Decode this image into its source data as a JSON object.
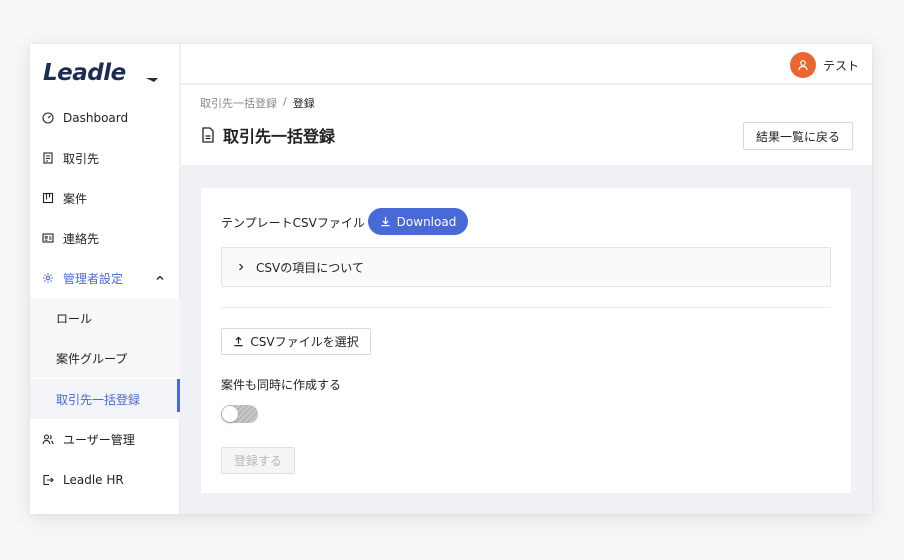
{
  "app": {
    "logo_text": "Leadle"
  },
  "sidebar": {
    "items": [
      {
        "label": "Dashboard",
        "icon": "dashboard-icon"
      },
      {
        "label": "取引先",
        "icon": "document-list-icon"
      },
      {
        "label": "案件",
        "icon": "kanban-icon"
      },
      {
        "label": "連絡先",
        "icon": "contact-card-icon"
      },
      {
        "label": "管理者設定",
        "icon": "gear-icon",
        "expanded": true
      },
      {
        "label": "ユーザー管理",
        "icon": "users-icon"
      },
      {
        "label": "Leadle HR",
        "icon": "external-link-icon"
      }
    ],
    "sub_items": [
      {
        "label": "ロール"
      },
      {
        "label": "案件グループ"
      },
      {
        "label": "取引先一括登録",
        "active": true
      }
    ]
  },
  "header": {
    "user_name": "テスト",
    "avatar_color": "#e8662f"
  },
  "breadcrumb": {
    "parent": "取引先一括登録",
    "separator": "/",
    "current": "登録"
  },
  "page": {
    "title": "取引先一括登録",
    "back_button": "結果一覧に戻る"
  },
  "form": {
    "template_label": "テンプレートCSVファイル",
    "download_button": "Download",
    "collapse_label": "CSVの項目について",
    "select_file_button": "CSVファイルを選択",
    "create_cases_label": "案件も同時に作成する",
    "create_cases_enabled": false,
    "submit_button": "登録する",
    "submit_disabled": true
  },
  "colors": {
    "accent": "#4869d6",
    "avatar": "#e8662f"
  }
}
